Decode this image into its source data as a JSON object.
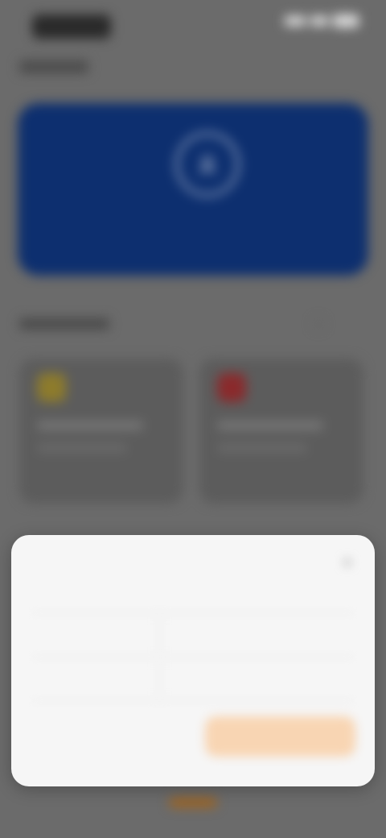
{
  "colors": {
    "hero": "#0d2f6f",
    "primary_button": "#f8d5b3",
    "sheet_bg": "#f6f6f6",
    "accent_blue": "#5b6bd6"
  },
  "icons": {
    "status_signal": "signal-icon",
    "status_wifi": "wifi-icon",
    "status_battery": "battery-icon",
    "hero": "face-icon",
    "card_left": "warning-icon",
    "card_right": "alert-icon",
    "close": "close-icon"
  },
  "sheet": {
    "title": "",
    "form_heading": "",
    "row1_label": "",
    "row1_value": "",
    "row2_label": "",
    "row2_value": "",
    "cancel_label": "",
    "confirm_label": ""
  }
}
